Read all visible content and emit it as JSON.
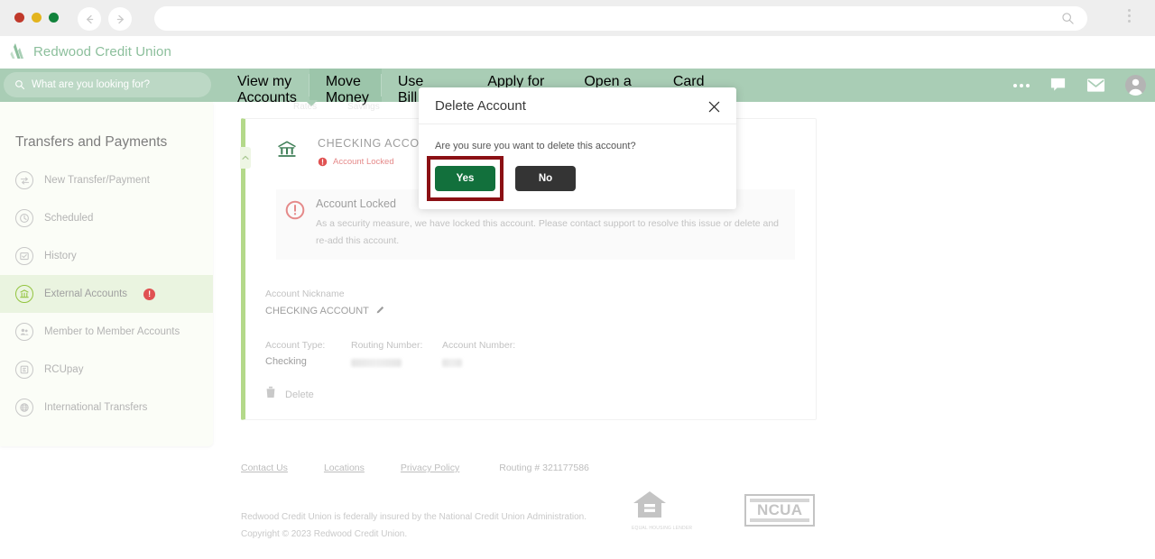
{
  "browser": {
    "back_icon": "back-arrow-icon",
    "forward_icon": "forward-arrow-icon",
    "url_value": "",
    "url_placeholder": "",
    "search_icon": "search-icon",
    "menu_icon": "kebab-menu-icon"
  },
  "brand": {
    "name": "Redwood Credit Union",
    "color": "#8cbf9c",
    "logo_icon": "redwood-trees-logo-icon"
  },
  "search": {
    "placeholder": "What are you looking for?",
    "value": "",
    "icon": "search-icon"
  },
  "nav": {
    "items": [
      {
        "line1": "View my",
        "line2": "Accounts",
        "active": false
      },
      {
        "line1": "Move",
        "line2": "Money",
        "active": true
      },
      {
        "line1": "Use",
        "line2": "Bill Pay",
        "active": false
      },
      {
        "line1": "Apply for",
        "line2": "",
        "active": false
      },
      {
        "line1": "Open a",
        "line2": "",
        "active": false
      },
      {
        "line1": "Card",
        "line2": "",
        "active": false
      }
    ],
    "right_icons": [
      "more-menu-icon",
      "chat-icon",
      "mail-icon",
      "avatar-icon"
    ]
  },
  "subnav": {
    "items": [
      "Rates",
      "Savings"
    ]
  },
  "sidebar": {
    "title": "Transfers and Payments",
    "items": [
      {
        "label": "New Transfer/Payment",
        "icon": "transfer-arrows-icon",
        "active": false,
        "badge": ""
      },
      {
        "label": "Scheduled",
        "icon": "clock-icon",
        "active": false,
        "badge": ""
      },
      {
        "label": "History",
        "icon": "history-icon",
        "active": false,
        "badge": ""
      },
      {
        "label": "External Accounts",
        "icon": "bank-icon",
        "active": true,
        "badge": "!"
      },
      {
        "label": "Member to Member Accounts",
        "icon": "people-icon",
        "active": false,
        "badge": ""
      },
      {
        "label": "RCUpay",
        "icon": "rcupay-icon",
        "active": false,
        "badge": ""
      },
      {
        "label": "International Transfers",
        "icon": "globe-icon",
        "active": false,
        "badge": ""
      }
    ]
  },
  "account_card": {
    "icon": "bank-building-icon",
    "title": "CHECKING ACCOUNT",
    "status_badge": {
      "icon": "alert-circle-icon",
      "text": "Account Locked"
    },
    "locked_banner": {
      "icon": "alert-circle-icon",
      "title": "Account Locked",
      "body": "As a security measure, we have locked this account. Please contact support to resolve this issue or delete and re-add this account."
    },
    "nickname_label": "Account Nickname",
    "nickname_value": "CHECKING ACCOUNT",
    "edit_icon": "pencil-edit-icon",
    "fields": [
      {
        "label": "Account Type:",
        "value": "Checking",
        "redacted": false
      },
      {
        "label": "Routing Number:",
        "value": "",
        "redacted": true
      },
      {
        "label": "Account Number:",
        "value": "",
        "redacted": true
      }
    ],
    "delete_label": "Delete",
    "delete_icon": "trash-icon",
    "collapse_icon": "chevron-up-icon"
  },
  "modal": {
    "title": "Delete Account",
    "close_icon": "close-icon",
    "message": "Are you sure you want to delete this account?",
    "confirm_label": "Yes",
    "cancel_label": "No",
    "confirm_color": "#12703c",
    "cancel_color": "#343434",
    "highlight_color": "#8b1014"
  },
  "footer": {
    "links": [
      "Contact Us",
      "Locations",
      "Privacy Policy"
    ],
    "routing": "Routing # 321177586",
    "legal_line1": "Redwood Credit Union is federally insured by the National Credit Union Administration.",
    "legal_line2": "Copyright © 2023 Redwood Credit Union.",
    "equal_housing_icon": "equal-housing-lender-icon",
    "equal_housing_label": "EQUAL HOUSING LENDER",
    "ncua_label": "NCUA"
  }
}
